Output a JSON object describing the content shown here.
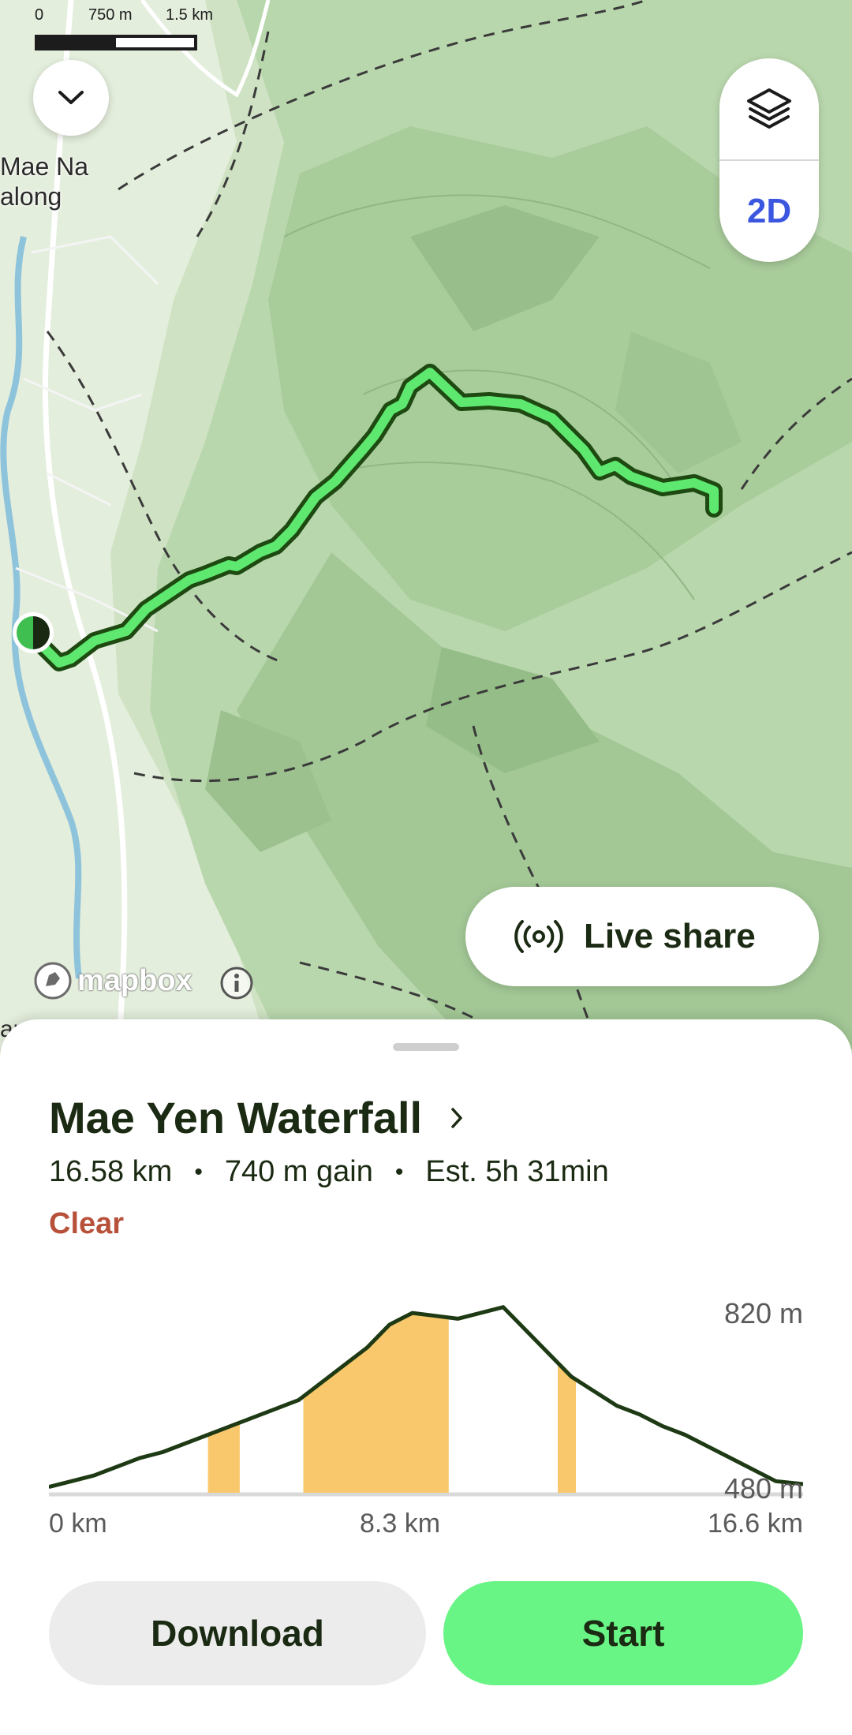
{
  "map": {
    "scale": {
      "zero": "0",
      "mid": "750 m",
      "end": "1.5 km"
    },
    "place_label_1": "Mae Na\nalong",
    "place_label_2": "an T...",
    "layers_icon": "layers-icon",
    "view_mode": "2D",
    "live_share_label": "Live share",
    "live_share_icon": "broadcast-icon",
    "attribution": "mapbox",
    "route_color": "#5ee86f",
    "route_outline_color": "#1e4a12"
  },
  "route": {
    "title": "Mae Yen Waterfall",
    "distance": "16.58 km",
    "gain": "740 m gain",
    "estimate": "Est. 5h 31min",
    "weather": "Clear"
  },
  "elevation": {
    "y_max_label": "820 m",
    "y_min_label": "480 m",
    "x_start_label": "0 km",
    "x_mid_label": "8.3 km",
    "x_end_label": "16.6 km",
    "highlight_color": "#f9c86c"
  },
  "actions": {
    "download_label": "Download",
    "start_label": "Start",
    "start_color": "#69f486"
  },
  "chart_data": {
    "type": "area",
    "x": [
      0,
      0.5,
      1,
      1.5,
      2,
      2.5,
      3,
      3.5,
      4,
      4.5,
      5,
      5.5,
      6,
      6.5,
      7,
      7.5,
      8,
      8.5,
      9,
      9.5,
      10,
      10.5,
      11,
      11.5,
      12,
      12.5,
      13,
      13.5,
      14,
      14.5,
      15,
      15.5,
      16,
      16.6
    ],
    "values": [
      490,
      500,
      510,
      525,
      540,
      550,
      565,
      580,
      595,
      610,
      625,
      640,
      670,
      700,
      730,
      770,
      790,
      785,
      780,
      790,
      800,
      760,
      720,
      680,
      655,
      630,
      615,
      595,
      580,
      560,
      540,
      520,
      500,
      495
    ],
    "xlabel": "",
    "ylabel": "",
    "ylim": [
      480,
      820
    ],
    "xlim": [
      0,
      16.6
    ],
    "highlighted_ranges_km": [
      [
        3.5,
        4.2
      ],
      [
        5.6,
        8.8
      ],
      [
        11.2,
        11.6
      ]
    ],
    "tick_labels": {
      "x": [
        "0 km",
        "8.3 km",
        "16.6 km"
      ],
      "y": [
        "820 m",
        "480 m"
      ]
    }
  }
}
